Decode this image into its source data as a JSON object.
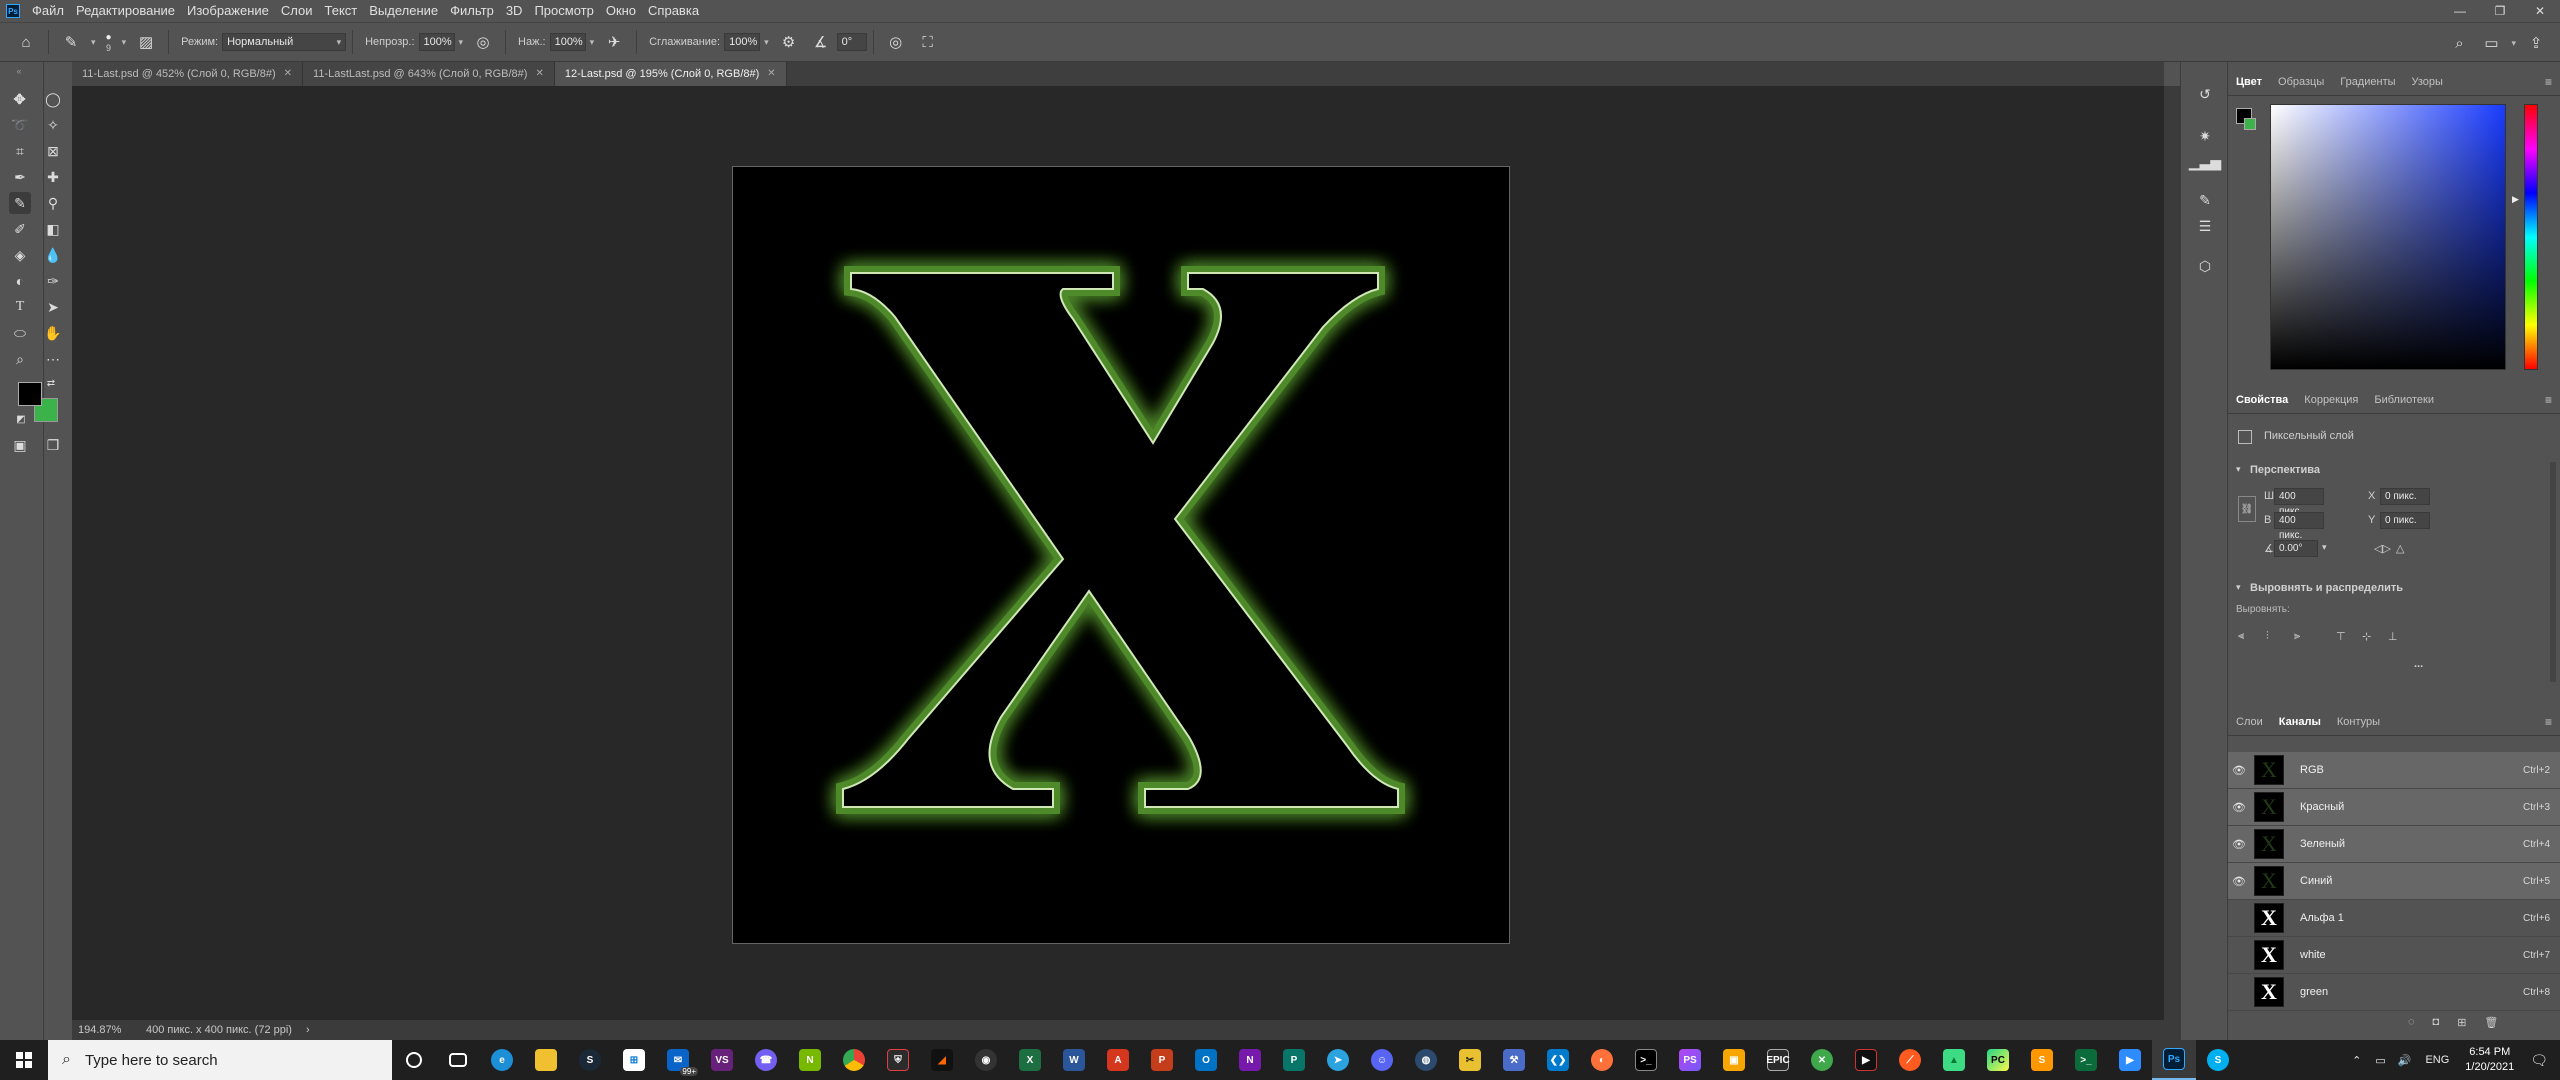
{
  "menubar": {
    "logo": "Ps",
    "items": [
      "Файл",
      "Редактирование",
      "Изображение",
      "Слои",
      "Текст",
      "Выделение",
      "Фильтр",
      "3D",
      "Просмотр",
      "Окно",
      "Справка"
    ]
  },
  "window_controls": {
    "minimize": "—",
    "restore": "❐",
    "close": "✕"
  },
  "options_bar": {
    "brush_size": "9",
    "mode_label": "Режим:",
    "mode_value": "Нормальный",
    "opacity_label": "Непрозр.:",
    "opacity_value": "100%",
    "flow_label": "Наж.:",
    "flow_value": "100%",
    "smoothing_label": "Сглаживание:",
    "smoothing_value": "100%",
    "angle_value": "0°"
  },
  "tabs": [
    {
      "label": "11-Last.psd @ 452% (Слой 0, RGB/8#)",
      "active": false
    },
    {
      "label": "11-LastLast.psd @ 643% (Слой 0, RGB/8#)",
      "active": false
    },
    {
      "label": "12-Last.psd @ 195% (Слой 0, RGB/8#)",
      "active": true
    }
  ],
  "canvas": {
    "letter": "X",
    "glow_color": "#4f8a2a",
    "edge_color": "#cfe8b6"
  },
  "status": {
    "zoom": "194.87%",
    "doc_info": "400 пикс. x 400 пикс. (72 ppi)",
    "arrow": "›"
  },
  "colors": {
    "foreground": "#000000",
    "background": "#3cb34a",
    "accent_hue_marker": "#1a3cff"
  },
  "color_panel": {
    "tabs": [
      "Цвет",
      "Образцы",
      "Градиенты",
      "Узоры"
    ],
    "active": "Цвет"
  },
  "properties_panel": {
    "tabs": [
      "Свойства",
      "Коррекция",
      "Библиотеки"
    ],
    "active": "Свойства",
    "layer_type": "Пиксельный слой",
    "section_transform": "Перспектива",
    "w_label": "Ш",
    "w_value": "400 пикс.",
    "h_label": "В",
    "h_value": "400 пикс.",
    "x_label": "X",
    "x_value": "0 пикс.",
    "y_label": "Y",
    "y_value": "0 пикс.",
    "angle_value": "0.00°",
    "section_align": "Выровнять и распределить",
    "align_label": "Выровнять:",
    "more": "..."
  },
  "channels_panel": {
    "tabs": [
      "Слои",
      "Каналы",
      "Контуры"
    ],
    "active": "Каналы",
    "rows": [
      {
        "name": "RGB",
        "shortcut": "Ctrl+2",
        "visible": true,
        "selected": true,
        "white": false
      },
      {
        "name": "Красный",
        "shortcut": "Ctrl+3",
        "visible": true,
        "selected": true,
        "white": false
      },
      {
        "name": "Зеленый",
        "shortcut": "Ctrl+4",
        "visible": true,
        "selected": true,
        "white": false
      },
      {
        "name": "Синий",
        "shortcut": "Ctrl+5",
        "visible": true,
        "selected": true,
        "white": false
      },
      {
        "name": "Альфа 1",
        "shortcut": "Ctrl+6",
        "visible": false,
        "selected": false,
        "white": true
      },
      {
        "name": "white",
        "shortcut": "Ctrl+7",
        "visible": false,
        "selected": false,
        "white": true
      },
      {
        "name": "green",
        "shortcut": "Ctrl+8",
        "visible": false,
        "selected": false,
        "white": true
      }
    ]
  },
  "taskbar": {
    "search_placeholder": "Type here to search",
    "mail_badge": "99+",
    "language": "ENG",
    "time": "6:54 PM",
    "date": "1/20/2021"
  }
}
